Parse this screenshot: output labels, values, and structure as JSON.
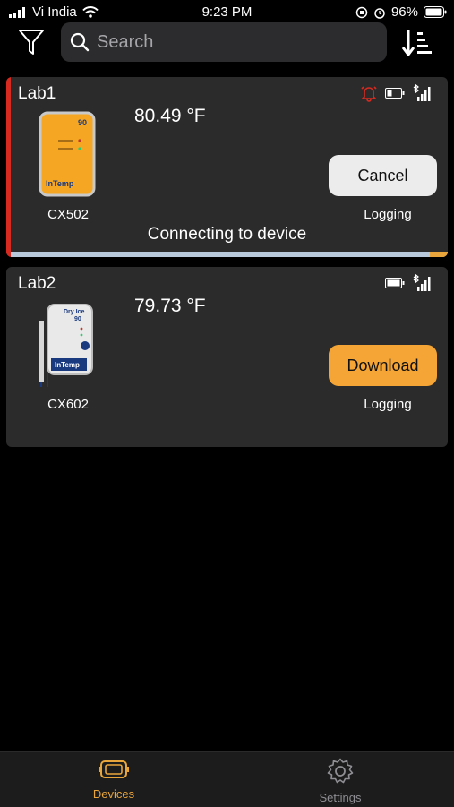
{
  "status_bar": {
    "carrier": "Vi India",
    "time": "9:23 PM",
    "battery": "96%"
  },
  "search": {
    "placeholder": "Search"
  },
  "devices": [
    {
      "name": "Lab1",
      "temperature": "80.49 °F",
      "model": "CX502",
      "image_label": "90",
      "brand": "InTemp",
      "action_label": "Cancel",
      "logging_status": "Logging",
      "connecting_text": "Connecting to device",
      "connect_progress": 0.04,
      "alarm": true
    },
    {
      "name": "Lab2",
      "temperature": "79.73 °F",
      "model": "CX602",
      "image_label_top": "Dry Ice",
      "image_label": "90",
      "brand": "InTemp",
      "action_label": "Download",
      "logging_status": "Logging",
      "alarm": false
    }
  ],
  "tabs": [
    {
      "label": "Devices",
      "active": true
    },
    {
      "label": "Settings",
      "active": false
    }
  ],
  "colors": {
    "accent_orange": "#f4a535",
    "alarm_red": "#d62a20",
    "card_bg": "#2b2b2b"
  }
}
